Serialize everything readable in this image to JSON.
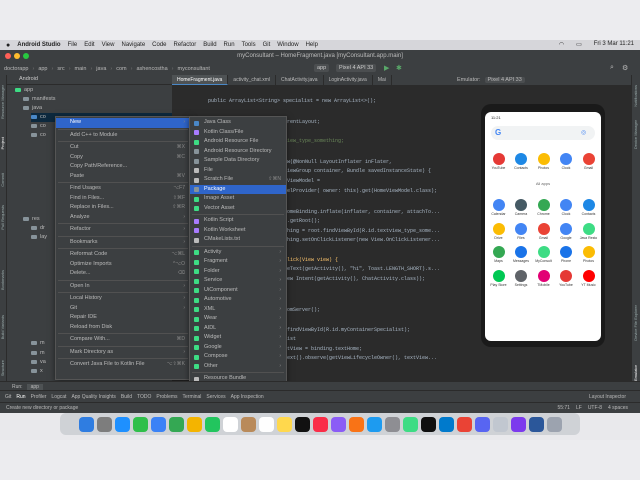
{
  "menubar": {
    "app_name": "Android Studio",
    "items": [
      "File",
      "Edit",
      "View",
      "Navigate",
      "Code",
      "Refactor",
      "Build",
      "Run",
      "Tools",
      "Git",
      "Window",
      "Help"
    ],
    "clock": "Fri 3 Mar 11:21"
  },
  "window": {
    "title": "myConsultant – HomeFragment.java [myConsultant.app.main]"
  },
  "toolbar": {
    "breadcrumbs": [
      "doctorapp",
      "app",
      "src",
      "main",
      "java",
      "com",
      "ashencostha",
      "myconsultant"
    ],
    "run_config": "app",
    "device": "Pixel 4 API 33"
  },
  "project_panel": {
    "view_mode": "Android",
    "rows": [
      "app",
      "manifests",
      "java",
      "co",
      "co",
      "co",
      "res",
      "dr",
      "lay",
      "m",
      "m",
      "va",
      "x",
      "Gra"
    ]
  },
  "editor_tabs": [
    "HomeFragment.java",
    "activity_chat.xml",
    "ChatActivity.java",
    "LoginActivity.java",
    "Mai"
  ],
  "code_lines": [
    "public ArrayList<String> specialist = new ArrayList<>();",
    "",
    "arentLayout;",
    "",
    "view_type_something;",
    "",
    "ew(@NonNull LayoutInflater inFlater,",
    "      ViewGroup container, Bundle savedInstanceState) {",
    "eViewModel =",
    "delProvider( owner: this).get(HomeViewModel.class);",
    "",
    "HomeBinding.inflate(inflater, container, attachTo...",
    "g.getRoot();",
    "thing = root.findViewById(R.id.textview_type_some...",
    "thing.setOnClickListener(new View.OnClickListener...",
    "",
    "Click(View view) {",
    "keText(getActivity(), \"hi\", Toast.LENGTH_SHORT).s...",
    "new Intent(getActivity(), ChatActivity.class));",
    "",
    "",
    "",
    "",
    "romServer();",
    "",
    "",
    ".findViewById(R.id.myContainerSpecialist);",
    "list",
    "xtView = binding.textHome;",
    "Text().observe(getViewLifecycleOwner(), textView..."
  ],
  "emulator": {
    "label": "Emulator:",
    "device": "Pixel 4 API 33",
    "status_time": "11:21",
    "section_label": "All apps",
    "favorites": [
      {
        "name": "YouTube",
        "color": "#e53935"
      },
      {
        "name": "Contacts",
        "color": "#1e88e5"
      },
      {
        "name": "Photos",
        "color": "#fbbc04"
      },
      {
        "name": "Clock",
        "color": "#4285f4"
      },
      {
        "name": "Gmail",
        "color": "#ea4335"
      }
    ],
    "apps": [
      {
        "name": "Calendar",
        "color": "#4285f4"
      },
      {
        "name": "Camera",
        "color": "#455a64"
      },
      {
        "name": "Chrome",
        "color": "#34a853"
      },
      {
        "name": "Clock",
        "color": "#4285f4"
      },
      {
        "name": "Contacts",
        "color": "#1e88e5"
      },
      {
        "name": "Drive",
        "color": "#fbbc04"
      },
      {
        "name": "Files",
        "color": "#4285f4"
      },
      {
        "name": "Gmail",
        "color": "#ea4335"
      },
      {
        "name": "Google",
        "color": "#4285f4"
      },
      {
        "name": "Java Resto",
        "color": "#3ddc84"
      },
      {
        "name": "Maps",
        "color": "#34a853"
      },
      {
        "name": "Messages",
        "color": "#1a73e8"
      },
      {
        "name": "MyConsult",
        "color": "#3ddc84"
      },
      {
        "name": "Phone",
        "color": "#1a73e8"
      },
      {
        "name": "Photos",
        "color": "#fbbc04"
      },
      {
        "name": "Play Store",
        "color": "#00c853"
      },
      {
        "name": "Settings",
        "color": "#5f6368"
      },
      {
        "name": "TMobile",
        "color": "#e20074"
      },
      {
        "name": "YouTube",
        "color": "#e53935"
      },
      {
        "name": "YT Music",
        "color": "#ff0000"
      }
    ]
  },
  "context_menu": {
    "items": [
      {
        "label": "New",
        "shortcut": "",
        "submenu": true,
        "highlight": true
      },
      {
        "sep": true
      },
      {
        "label": "Add C++ to Module",
        "shortcut": ""
      },
      {
        "sep": true
      },
      {
        "label": "Cut",
        "shortcut": "⌘X"
      },
      {
        "label": "Copy",
        "shortcut": "⌘C"
      },
      {
        "label": "Copy Path/Reference...",
        "shortcut": ""
      },
      {
        "label": "Paste",
        "shortcut": "⌘V"
      },
      {
        "sep": true
      },
      {
        "label": "Find Usages",
        "shortcut": "⌥F7"
      },
      {
        "label": "Find in Files...",
        "shortcut": "⇧⌘F"
      },
      {
        "label": "Replace in Files...",
        "shortcut": "⇧⌘R"
      },
      {
        "label": "Analyze",
        "shortcut": "",
        "submenu": true
      },
      {
        "sep": true
      },
      {
        "label": "Refactor",
        "shortcut": "",
        "submenu": true
      },
      {
        "sep": true
      },
      {
        "label": "Bookmarks",
        "shortcut": "",
        "submenu": true
      },
      {
        "sep": true
      },
      {
        "label": "Reformat Code",
        "shortcut": "⌥⌘L"
      },
      {
        "label": "Optimize Imports",
        "shortcut": "^⌥O"
      },
      {
        "label": "Delete...",
        "shortcut": "⌫"
      },
      {
        "sep": true
      },
      {
        "label": "Open In",
        "shortcut": "",
        "submenu": true
      },
      {
        "sep": true
      },
      {
        "label": "Local History",
        "shortcut": "",
        "submenu": true
      },
      {
        "label": "Git",
        "shortcut": "",
        "submenu": true
      },
      {
        "label": "Repair IDE",
        "shortcut": ""
      },
      {
        "label": "Reload from Disk",
        "shortcut": ""
      },
      {
        "sep": true
      },
      {
        "label": "Compare With...",
        "shortcut": "⌘D"
      },
      {
        "sep": true
      },
      {
        "label": "Mark Directory as",
        "shortcut": "",
        "submenu": true
      },
      {
        "sep": true
      },
      {
        "label": "Convert Java File to Kotlin File",
        "shortcut": "⌥⇧⌘K"
      }
    ]
  },
  "new_submenu": {
    "items": [
      {
        "label": "Java Class",
        "color": "#4a88c7"
      },
      {
        "label": "Kotlin Class/File",
        "color": "#a97bff"
      },
      {
        "label": "Android Resource File",
        "color": "#3ddc84"
      },
      {
        "label": "Android Resource Directory",
        "color": "#87939a"
      },
      {
        "label": "Sample Data Directory",
        "color": "#87939a"
      },
      {
        "label": "File",
        "color": "#bbbbbb"
      },
      {
        "label": "Scratch File",
        "color": "#bbbbbb",
        "shortcut": "⇧⌘N"
      },
      {
        "label": "Package",
        "color": "#87939a",
        "highlight": true
      },
      {
        "label": "Image Asset",
        "color": "#3ddc84"
      },
      {
        "label": "Vector Asset",
        "color": "#3ddc84"
      },
      {
        "sep": true
      },
      {
        "label": "Kotlin Script",
        "color": "#a97bff"
      },
      {
        "label": "Kotlin Worksheet",
        "color": "#a97bff"
      },
      {
        "label": "CMakeLists.txt",
        "color": "#bbbbbb"
      },
      {
        "sep": true
      },
      {
        "label": "Activity",
        "color": "#3ddc84",
        "submenu": true
      },
      {
        "label": "Fragment",
        "color": "#3ddc84",
        "submenu": true
      },
      {
        "label": "Folder",
        "color": "#3ddc84",
        "submenu": true
      },
      {
        "label": "Service",
        "color": "#3ddc84",
        "submenu": true
      },
      {
        "label": "UiComponent",
        "color": "#3ddc84",
        "submenu": true
      },
      {
        "label": "Automotive",
        "color": "#3ddc84",
        "submenu": true
      },
      {
        "label": "XML",
        "color": "#3ddc84",
        "submenu": true
      },
      {
        "label": "Wear",
        "color": "#3ddc84",
        "submenu": true
      },
      {
        "label": "AIDL",
        "color": "#3ddc84",
        "submenu": true
      },
      {
        "label": "Widget",
        "color": "#3ddc84",
        "submenu": true
      },
      {
        "label": "Google",
        "color": "#3ddc84",
        "submenu": true
      },
      {
        "label": "Compose",
        "color": "#3ddc84",
        "submenu": true
      },
      {
        "label": "Other",
        "color": "#3ddc84",
        "submenu": true
      },
      {
        "sep": true
      },
      {
        "label": "Resource Bundle",
        "color": "#bbbbbb"
      },
      {
        "label": "EditorConfig File",
        "color": "#bbbbbb"
      }
    ]
  },
  "run_panel": {
    "label": "Run:",
    "config": "app"
  },
  "tool_tabs": [
    "Git",
    "Run",
    "Profiler",
    "Logcat",
    "App Quality Insights",
    "Build",
    "TODO",
    "Problems",
    "Terminal",
    "Services",
    "App Inspection",
    "Layout Inspector"
  ],
  "statusbar": {
    "message": "Create new directory or package",
    "position": "55:71",
    "line_sep": "LF",
    "encoding": "UTF-8",
    "indent": "4 spaces"
  }
}
